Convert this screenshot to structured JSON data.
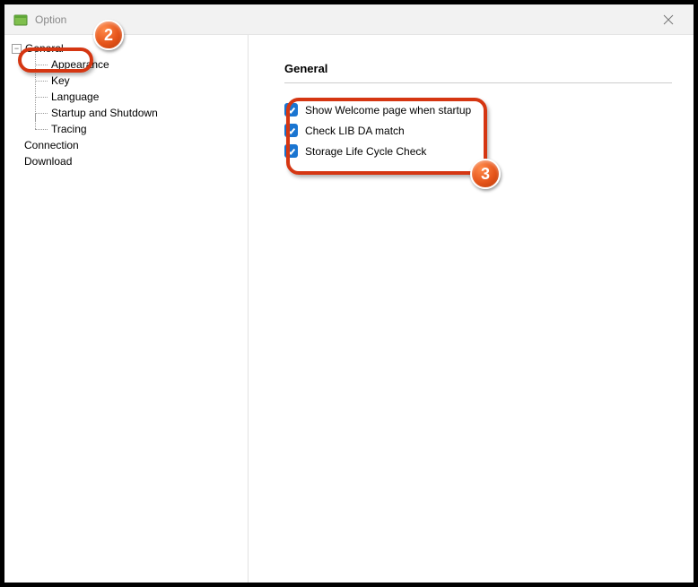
{
  "window": {
    "title": "Option"
  },
  "tree": {
    "root": "General",
    "children": [
      "Appearance",
      "Key",
      "Language",
      "Startup and Shutdown",
      "Tracing"
    ],
    "siblings": [
      "Connection",
      "Download"
    ]
  },
  "content": {
    "heading": "General",
    "options": [
      "Show Welcome page when startup",
      "Check LIB DA match",
      "Storage Life Cycle Check"
    ]
  },
  "annotations": {
    "badge2": "2",
    "badge3": "3"
  }
}
